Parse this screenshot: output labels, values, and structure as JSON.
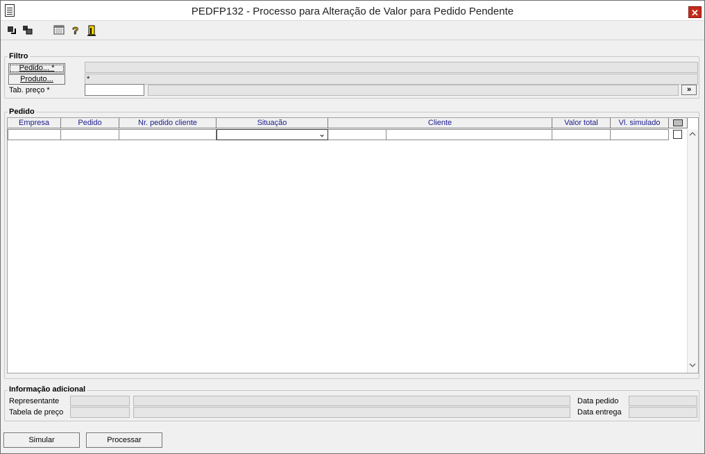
{
  "window": {
    "title": "PEDFP132 - Processo para Alteração de Valor para Pedido Pendente",
    "close_glyph": "✕"
  },
  "toolbar": {
    "icons": [
      "arrow-in-icon",
      "copy-icon",
      "calendar-icon",
      "help-icon",
      "exit-icon"
    ]
  },
  "filtro": {
    "title": "Filtro",
    "pedido_button": "Pedido... *",
    "produto_button": "Produto...",
    "produto_value": "*",
    "tab_preco_label": "Tab. preço *",
    "tab_preco_value": "",
    "expand_button": "»"
  },
  "pedido_grid": {
    "title": "Pedido",
    "columns": [
      "Empresa",
      "Pedido",
      "Nr. pedido cliente",
      "Situação",
      "Cliente",
      "Valor total",
      "Vl. simulado"
    ],
    "row_situacao_dropdown": "⌄"
  },
  "info": {
    "title": "Informação adicional",
    "representante_label": "Representante",
    "tabela_preco_label": "Tabela de preço",
    "data_pedido_label": "Data pedido",
    "data_entrega_label": "Data entrega"
  },
  "actions": {
    "simular_label": "Simular",
    "processar_label": "Processar"
  }
}
